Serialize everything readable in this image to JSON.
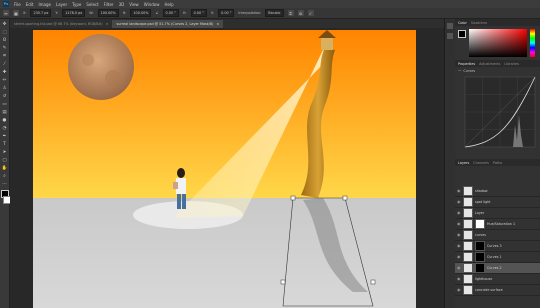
{
  "menu": [
    "File",
    "Edit",
    "Image",
    "Layer",
    "Type",
    "Select",
    "Filter",
    "3D",
    "View",
    "Window",
    "Help"
  ],
  "options": {
    "x_value": "235.7 px",
    "y_value": "1178.0 px",
    "w_value": "100.00%",
    "h_value": "100.00%",
    "angle_value": "0.00 °",
    "h_skew": "0.00 °",
    "v_skew": "0.00 °",
    "interpolation_label": "Interpolation:",
    "interpolation_value": "Bicubic"
  },
  "tabs": [
    {
      "label": "street-sporting-list.psd @ 66.7% (Keyword, RGB/8#)",
      "active": false
    },
    {
      "label": "surreal landscape.psd @ 51.7% (Curves 2, Layer Mask/8)",
      "active": true
    }
  ],
  "right": {
    "color_tabs": [
      "Color",
      "Swatches"
    ],
    "properties_tabs": [
      "Properties",
      "Adjustments",
      "Libraries"
    ],
    "properties_title": "Curves",
    "layers_tabs": [
      "Layers",
      "Channels",
      "Paths"
    ],
    "layers": [
      {
        "name": "shadow",
        "thumb": "light",
        "mask": null,
        "selected": false
      },
      {
        "name": "spot light",
        "thumb": "light",
        "mask": null,
        "selected": false
      },
      {
        "name": "Layer",
        "thumb": "light",
        "mask": null,
        "selected": false
      },
      {
        "name": "Hue/Saturation 1",
        "thumb": "light",
        "mask": "white",
        "selected": false
      },
      {
        "name": "curves",
        "thumb": "light",
        "mask": null,
        "selected": false
      },
      {
        "name": "Curves 3",
        "thumb": "light",
        "mask": "black",
        "selected": false
      },
      {
        "name": "Curves 1",
        "thumb": "light",
        "mask": "black",
        "selected": false
      },
      {
        "name": "Curves 2",
        "thumb": "light",
        "mask": "black",
        "selected": true
      },
      {
        "name": "lighthouse",
        "thumb": "light",
        "mask": null,
        "selected": false
      },
      {
        "name": "concrete surface",
        "thumb": "light",
        "mask": null,
        "selected": false
      }
    ]
  },
  "colors": {
    "sky_top": "#ff8a00",
    "sky_bottom": "#ffd23a",
    "ground": "#cfcfcf",
    "accent": "#4aa3e0"
  }
}
